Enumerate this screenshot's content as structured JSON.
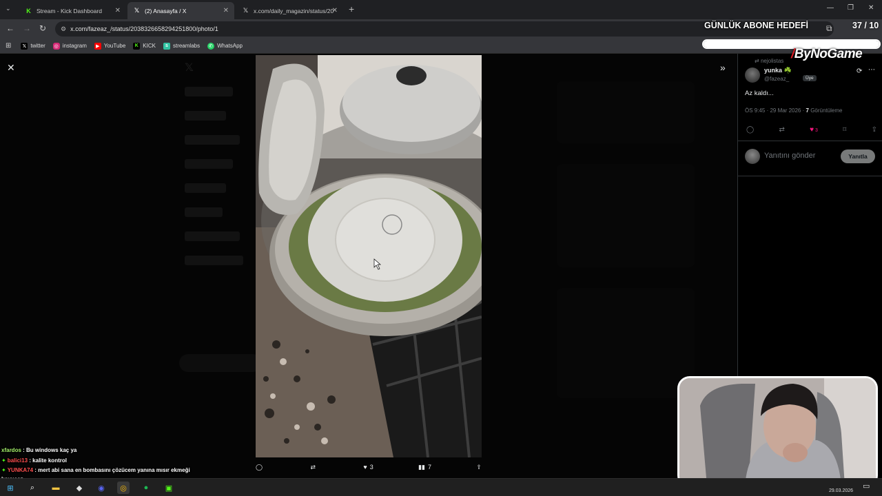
{
  "browser": {
    "tabs": [
      {
        "title": "Stream - Kick Dashboard",
        "icon": "kick-icon",
        "active": false
      },
      {
        "title": "(2) Anasayfa / X",
        "icon": "x-icon",
        "active": true
      },
      {
        "title": "x.com/daily_magazin/status/20",
        "icon": "x-icon",
        "active": false
      }
    ],
    "new_tab": "+",
    "url": "x.com/fazeaz_/status/2038326658294251800/photo/1",
    "bookmarks": [
      {
        "label": "twitter",
        "icon": "x-icon",
        "color": "#000000"
      },
      {
        "label": "instagram",
        "icon": "instagram-icon",
        "color": "#d62976"
      },
      {
        "label": "YouTube",
        "icon": "youtube-icon",
        "color": "#ff0000"
      },
      {
        "label": "KICK",
        "icon": "kick-icon",
        "color": "#53fc18"
      },
      {
        "label": "streamlabs",
        "icon": "streamlabs-icon",
        "color": "#31c3a2"
      },
      {
        "label": "WhatsApp",
        "icon": "whatsapp-icon",
        "color": "#25d366"
      }
    ]
  },
  "media": {
    "actions": {
      "reply_count": "",
      "repost_count": "",
      "like_count": "3",
      "view_count": "7"
    }
  },
  "tweet": {
    "reposted_by": "nejolistas",
    "author_name": "yunka ☘️",
    "author_handle": "@fazeaz_",
    "member_badge": "Üye",
    "text": "Az kaldı...",
    "time": "ÖS 9:45 · 29 Mar 2026",
    "views": "7",
    "views_label": "Görüntüleme",
    "like_count": "3",
    "reply_placeholder": "Yanıtını gönder",
    "reply_button": "Yanıtla"
  },
  "stream_overlay": {
    "goal_title": "GÜNLÜK ABONE HEDEFİ",
    "goal_count": "37 / 10",
    "goal_progress": 1.0,
    "sponsor": "ByNoGame"
  },
  "chat": [
    {
      "user": "xfardos",
      "user_color": "#a6f26b",
      "message": "Bu windows kaç ya",
      "badge": false
    },
    {
      "user": "balici13",
      "user_color": "#ff4f4f",
      "message": "kalite kontrol",
      "badge": true
    },
    {
      "user": "YUNKA74",
      "user_color": "#ff4f4f",
      "message": "mert abi sana en bombasını çözücem yanına mısır ekmeği koyucaz",
      "badge": true
    }
  ],
  "taskbar": {
    "date": "29.03.2026"
  },
  "colors": {
    "accent_like": "#f91880",
    "kick_green": "#53fc18"
  }
}
